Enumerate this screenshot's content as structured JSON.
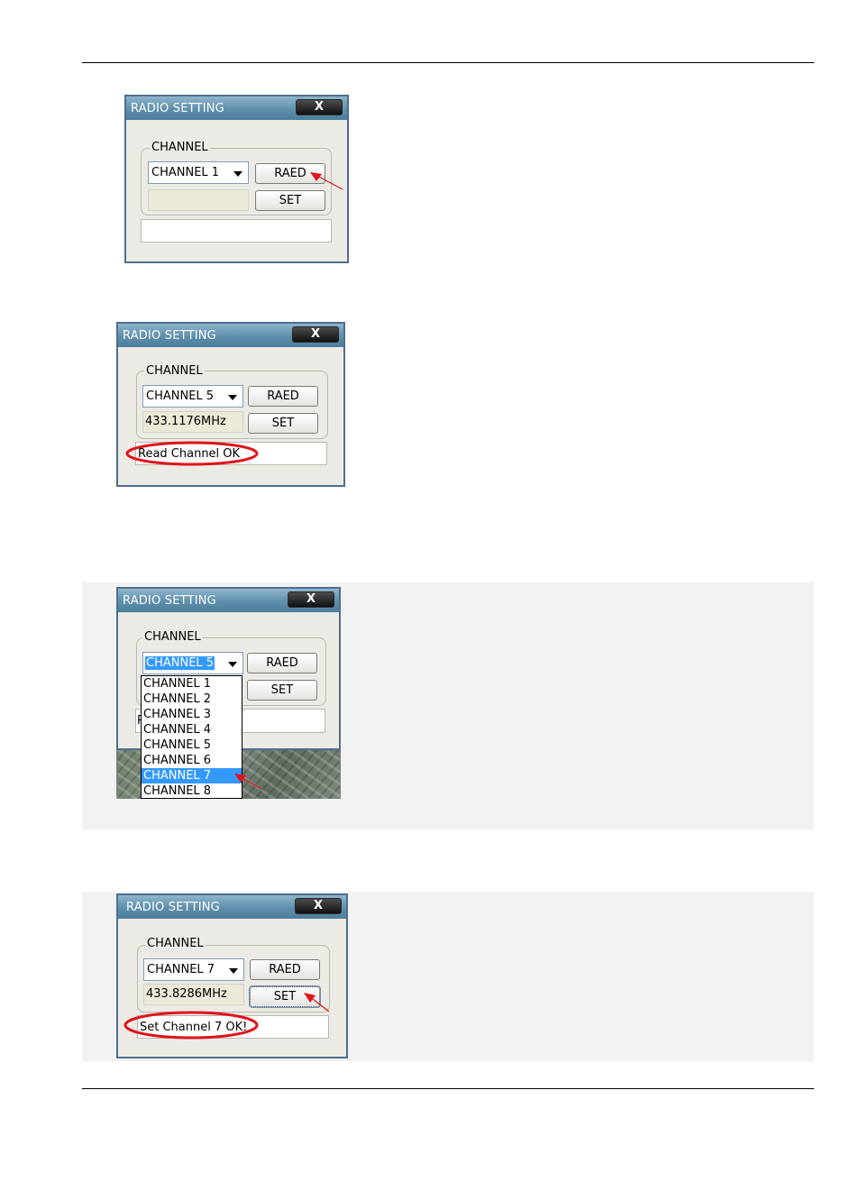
{
  "windows": [
    {
      "title": "RADIO SETTING",
      "close_label": "X",
      "group_label": "CHANNEL",
      "selected_channel": "CHANNEL 1",
      "frequency": "",
      "read_label": "RAED",
      "set_label": "SET",
      "status": ""
    },
    {
      "title": "RADIO SETTING",
      "close_label": "X",
      "group_label": "CHANNEL",
      "selected_channel": "CHANNEL 5",
      "frequency": "433.1176MHz",
      "read_label": "RAED",
      "set_label": "SET",
      "status": "Read Channel OK"
    },
    {
      "title": "RADIO SETTING",
      "close_label": "X",
      "group_label": "CHANNEL",
      "selected_channel": "CHANNEL 5",
      "read_label": "RAED",
      "set_label": "SET",
      "status_partial": "R",
      "dropdown_options": [
        "CHANNEL 1",
        "CHANNEL 2",
        "CHANNEL 3",
        "CHANNEL 4",
        "CHANNEL 5",
        "CHANNEL 6",
        "CHANNEL 7",
        "CHANNEL 8"
      ],
      "highlighted_option": "CHANNEL 7"
    },
    {
      "title": "RADIO SETTING",
      "close_label": "X",
      "group_label": "CHANNEL",
      "selected_channel": "CHANNEL 7",
      "frequency": "433.8286MHz",
      "read_label": "RAED",
      "set_label": "SET",
      "status": "Set Channel 7 OK!"
    }
  ],
  "colors": {
    "annotation": "#e0121b",
    "titlebar": "#5d8fab",
    "highlight": "#3399ff"
  }
}
